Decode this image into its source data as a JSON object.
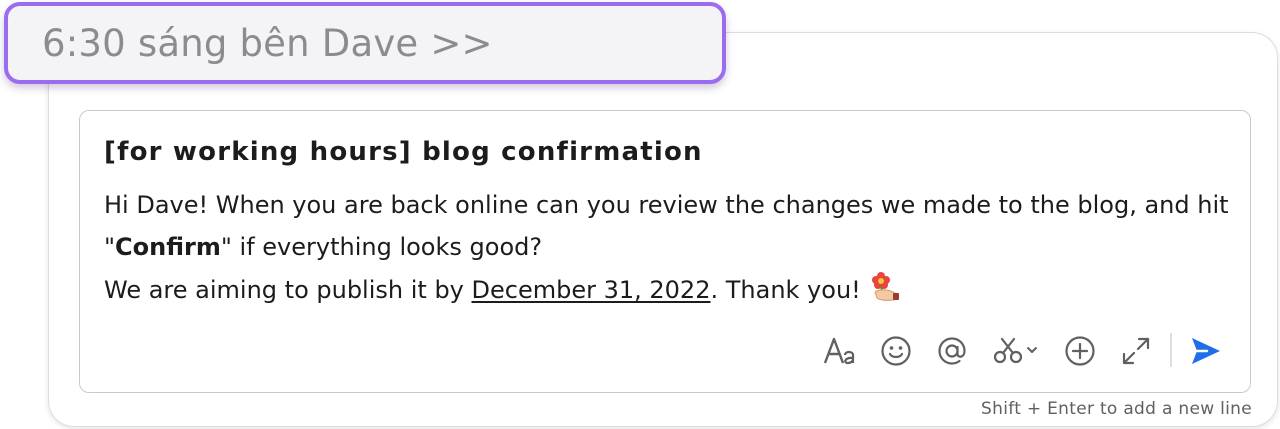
{
  "header": {
    "schedule_label": "6:30 sáng bên Dave >>"
  },
  "message": {
    "title": "[for working hours] blog confirmation",
    "line1": "Hi Dave! When you are back online can you review the changes we made to the blog, and hit",
    "line2_open_quote": "\"",
    "line2_bold": "Confirm",
    "line2_rest": "\" if everything looks good?",
    "line3_prefix": "We are aiming to publish it by ",
    "line3_date": "December 31, 2022",
    "line3_suffix": ". Thank you!",
    "emoji": "flower-hands-emoji"
  },
  "toolbar": {
    "items": [
      "format-text-icon",
      "emoji-icon",
      "mention-icon",
      "shortcuts-icon",
      "attach-add-icon",
      "expand-icon",
      "send-icon"
    ],
    "icon_color": "#616061",
    "send_color": "#1f6fe8"
  },
  "footer": {
    "hint": "Shift + Enter to add a new line"
  },
  "colors": {
    "accent_border": "#9b6cf0",
    "chip_background": "#f4f4f7",
    "text": "#1d1c1d"
  }
}
